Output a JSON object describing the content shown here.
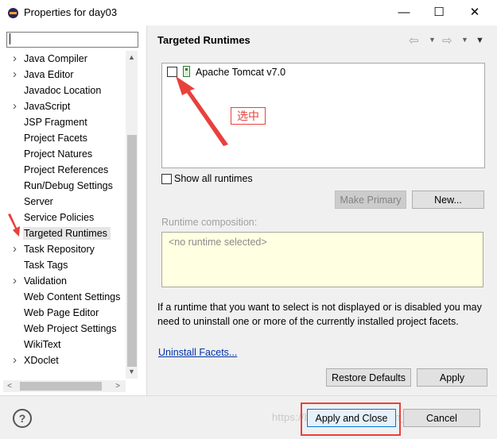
{
  "window": {
    "title": "Properties for day03",
    "controls": {
      "minimize": "—",
      "maximize": "☐",
      "close": "✕"
    }
  },
  "sidebar": {
    "filter_value": "",
    "items": [
      {
        "label": "Java Compiler",
        "expandable": true
      },
      {
        "label": "Java Editor",
        "expandable": true
      },
      {
        "label": "Javadoc Location",
        "expandable": false
      },
      {
        "label": "JavaScript",
        "expandable": true
      },
      {
        "label": "JSP Fragment",
        "expandable": false
      },
      {
        "label": "Project Facets",
        "expandable": false
      },
      {
        "label": "Project Natures",
        "expandable": false
      },
      {
        "label": "Project References",
        "expandable": false
      },
      {
        "label": "Run/Debug Settings",
        "expandable": false
      },
      {
        "label": "Server",
        "expandable": false
      },
      {
        "label": "Service Policies",
        "expandable": false
      },
      {
        "label": "Targeted Runtimes",
        "expandable": false,
        "selected": true
      },
      {
        "label": "Task Repository",
        "expandable": true
      },
      {
        "label": "Task Tags",
        "expandable": false
      },
      {
        "label": "Validation",
        "expandable": true
      },
      {
        "label": "Web Content Settings",
        "expandable": false
      },
      {
        "label": "Web Page Editor",
        "expandable": false
      },
      {
        "label": "Web Project Settings",
        "expandable": false
      },
      {
        "label": "WikiText",
        "expandable": false
      },
      {
        "label": "XDoclet",
        "expandable": true
      }
    ]
  },
  "page": {
    "title": "Targeted Runtimes",
    "runtimes": [
      {
        "label": "Apache Tomcat v7.0",
        "checked": false
      }
    ],
    "annotation": "选中",
    "show_all_label": "Show all runtimes",
    "make_primary_label": "Make Primary",
    "new_label": "New...",
    "composition_label": "Runtime composition:",
    "composition_placeholder": "<no runtime selected>",
    "info_text": "If a runtime that you want to select is not displayed or is disabled you may need to uninstall one or more of the currently installed project facets.",
    "uninstall_link": "Uninstall Facets...",
    "restore_defaults_label": "Restore Defaults",
    "apply_label": "Apply"
  },
  "footer": {
    "help": "?",
    "apply_close_label": "Apply and Close",
    "cancel_label": "Cancel",
    "watermark": "https://blog.csdn.net/weixin_41957098"
  },
  "colors": {
    "annotation_red": "#e8413c",
    "link_blue": "#0033a8",
    "composition_bg": "#ffffe1",
    "focus_blue": "#0078d7"
  }
}
